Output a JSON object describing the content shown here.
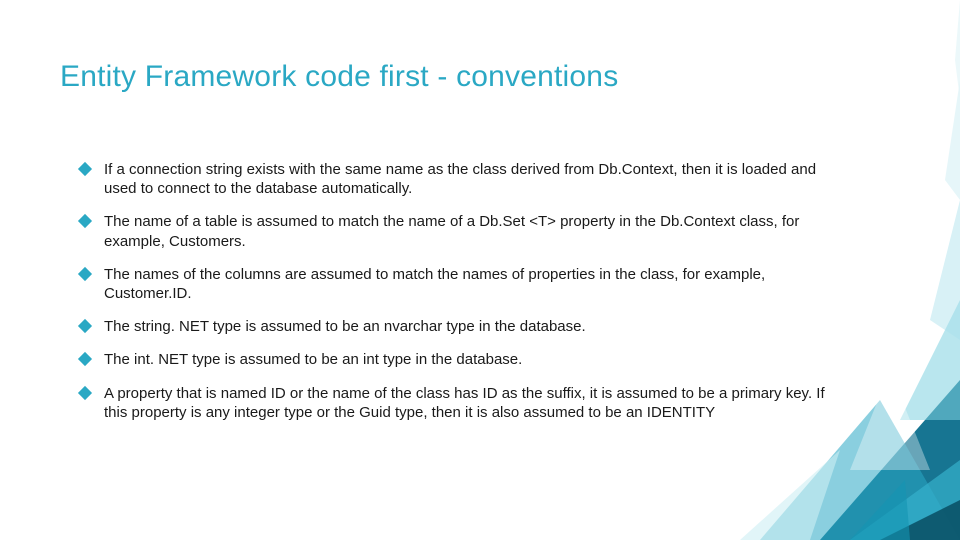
{
  "title": "Entity Framework code first - conventions",
  "bullets": [
    "If a connection string exists with the same name as the class derived from Db.Context, then it is loaded and used to connect to the database automatically.",
    "The name of a table is assumed to match the name of a Db.Set <T> property in the Db.Context class, for example, Customers.",
    "The names of the columns are assumed to match the names of properties in the class, for example, Customer.ID.",
    "The string. NET type is assumed to be an nvarchar type in the database.",
    "The int. NET type is assumed to be an int type in the database.",
    "A property that is named ID or the name of the class has ID as the suffix, it is assumed to be a primary key. If this property is any integer type or the Guid type, then it is also assumed to be an IDENTITY"
  ],
  "accent_color": "#2aa8c4"
}
